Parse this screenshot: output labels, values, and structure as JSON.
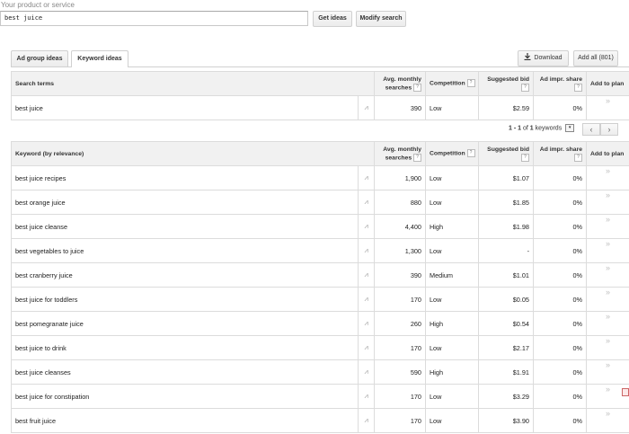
{
  "search": {
    "label": "Your product or service",
    "value": "best juice"
  },
  "buttons": {
    "get_ideas": "Get ideas",
    "modify_search": "Modify search",
    "download": "Download",
    "add_all": "Add all (801)"
  },
  "tabs": [
    "Ad group ideas",
    "Keyword ideas"
  ],
  "search_terms_table": {
    "headers": {
      "term": "Search terms",
      "avg_monthly_1": "Avg. monthly",
      "avg_monthly_2": "searches",
      "competition": "Competition",
      "suggested_bid": "Suggested bid",
      "ad_impr_1": "Ad impr. share",
      "add_to_plan": "Add to plan"
    },
    "rows": [
      {
        "keyword": "best juice",
        "searches": "390",
        "competition": "Low",
        "bid": "$2.59",
        "share": "0%"
      }
    ]
  },
  "pager": {
    "prefix": "1 - 1",
    "mid": "of",
    "count": "1",
    "suffix": "keywords",
    "dropdown": "▾",
    "prev": "‹",
    "next": "›"
  },
  "keyword_table": {
    "headers": {
      "keyword": "Keyword (by relevance)",
      "avg_monthly_1": "Avg. monthly",
      "avg_monthly_2": "searches",
      "competition": "Competition",
      "suggested_bid": "Suggested bid",
      "ad_impr_1": "Ad impr. share",
      "add_to_plan": "Add to plan"
    },
    "rows": [
      {
        "keyword": "best juice recipes",
        "searches": "1,900",
        "competition": "Low",
        "bid": "$1.07",
        "share": "0%"
      },
      {
        "keyword": "best orange juice",
        "searches": "880",
        "competition": "Low",
        "bid": "$1.85",
        "share": "0%"
      },
      {
        "keyword": "best juice cleanse",
        "searches": "4,400",
        "competition": "High",
        "bid": "$1.98",
        "share": "0%"
      },
      {
        "keyword": "best vegetables to juice",
        "searches": "1,300",
        "competition": "Low",
        "bid": "-",
        "share": "0%"
      },
      {
        "keyword": "best cranberry juice",
        "searches": "390",
        "competition": "Medium",
        "bid": "$1.01",
        "share": "0%"
      },
      {
        "keyword": "best juice for toddlers",
        "searches": "170",
        "competition": "Low",
        "bid": "$0.05",
        "share": "0%"
      },
      {
        "keyword": "best pomegranate juice",
        "searches": "260",
        "competition": "High",
        "bid": "$0.54",
        "share": "0%"
      },
      {
        "keyword": "best juice to drink",
        "searches": "170",
        "competition": "Low",
        "bid": "$2.17",
        "share": "0%"
      },
      {
        "keyword": "best juice cleanses",
        "searches": "590",
        "competition": "High",
        "bid": "$1.91",
        "share": "0%"
      },
      {
        "keyword": "best juice for constipation",
        "searches": "170",
        "competition": "Low",
        "bid": "$3.29",
        "share": "0%"
      },
      {
        "keyword": "best fruit juice",
        "searches": "170",
        "competition": "Low",
        "bid": "$3.90",
        "share": "0%"
      }
    ]
  },
  "icons": {
    "chart": "trend-chart-icon",
    "add": "add-to-plan-icon",
    "download": "download-icon",
    "help": "help-icon"
  },
  "glyphs": {
    "help": "?",
    "add": "»",
    "chart": "⩘"
  }
}
